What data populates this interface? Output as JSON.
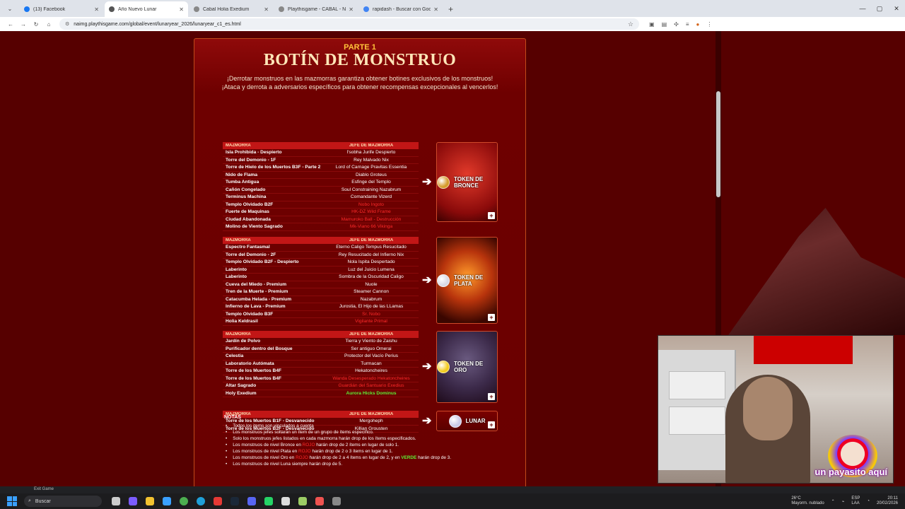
{
  "browser": {
    "tabs": [
      {
        "title": "(13) Facebook",
        "color": "#1877f2",
        "active": false
      },
      {
        "title": "Año Nuevo Lunar",
        "color": "#555",
        "active": true
      },
      {
        "title": "Cabal Holia Exedium",
        "color": "#888",
        "active": false
      },
      {
        "title": "Playthisgame - CABAL - Notici",
        "color": "#888",
        "active": false
      },
      {
        "title": "rapidash - Buscar con Google",
        "color": "#4285f4",
        "active": false
      }
    ],
    "url": "naimg.playthisgame.com/global/event/lunaryear_2026/lunaryear_c1_es.html"
  },
  "page": {
    "part": "PARTE 1",
    "title": "BOTÍN DE MONSTRUO",
    "intro_1": "¡Derrotar monstruos en las mazmorras garantiza obtener botines exclusivos de los monstruos!",
    "intro_2": "¡Ataca y derrota a adversarios específicos para obtener recompensas excepcionales al vencerlos!",
    "col_dungeon": "MAZMORRA",
    "col_boss": "JEFE DE MAZMORRA",
    "groups": [
      {
        "token": "TOKEN DE BRONCE",
        "coin_color": "#d59a2a",
        "card_bg": "radial-gradient(circle at 50% 40%,#e23a2a,#8a0a0a 70%,#3a0000)",
        "rows": [
          [
            "Isla Prohibida - Despierto",
            "l'sobha Jurife Despierto",
            ""
          ],
          [
            "Torre del Demonio - 1F",
            "Rey Malvado Nix",
            ""
          ],
          [
            "Torre de Hielo de los Muertos B3F - Parte 2",
            "Lord of Carnage Pravitas Essentia",
            ""
          ],
          [
            "Nido de Flama",
            "Diablo Groteus",
            ""
          ],
          [
            "Tumba Antigua",
            "Esfinge del Templo",
            ""
          ],
          [
            "Cañón Congelado",
            "Soul Constraining Nazabrum",
            ""
          ],
          [
            "Terminus Machina",
            "Comandante Vizerd",
            ""
          ],
          [
            "Templo Olvidado B2F",
            "Nobo Ingoto",
            "red"
          ],
          [
            "Fuerte de Maquinas",
            "HK-DZ Wild Frame",
            "red"
          ],
          [
            "Ciudad Abandonada",
            "Mamuroko Ball - Destrucción",
            "red"
          ],
          [
            "Molino de Viento Sagrado",
            "Mk-Viano 66 Vikinga",
            "red"
          ]
        ]
      },
      {
        "token": "TOKEN DE PLATA",
        "coin_color": "#d8d8e4",
        "card_bg": "radial-gradient(circle at 50% 45%,#ff9a2a,#b8340c 45%,#3a0600 85%)",
        "rows": [
          [
            "Espectro Fantasmal",
            "Eterno Caligo Tempus Resucitado",
            ""
          ],
          [
            "Torre del Demonio - 2F",
            "Rey Resucitado del Infierno Nix",
            ""
          ],
          [
            "Templo Olvidado B2F - Despierto",
            "Nola Ispita Despertado",
            ""
          ],
          [
            "Laberinto",
            "Luz del Juicio Lumena",
            ""
          ],
          [
            "Laberinto",
            "Sombra de la Oscuridad Caligo",
            ""
          ],
          [
            "Cueva del Miedo - Premium",
            "Nuole",
            ""
          ],
          [
            "Tren de la Muerte - Premium",
            "Steamer Cannon",
            ""
          ],
          [
            "Catacumba Helada - Premium",
            "Nazabrum",
            ""
          ],
          [
            "Infierno de Lava - Premium",
            "Jurostia, El Hijo de las LLamas",
            ""
          ],
          [
            "Templo Olvidado B3F",
            "Sr. Nobo",
            "red"
          ],
          [
            "Holia Keldrasil",
            "Vigilante Primal",
            "red"
          ]
        ]
      },
      {
        "token": "TOKEN DE ORO",
        "coin_color": "#f2cc1e",
        "card_bg": "radial-gradient(circle at 50% 40%,#6a5a80,#3c2a4a 55%,#1e0a1a)",
        "rows": [
          [
            "Jardín de Polvo",
            "Tierra y Viento de Zaishu",
            ""
          ],
          [
            "Purificador dentro del Bosque",
            "Ser antiguo Omerai",
            ""
          ],
          [
            "Celestia",
            "Protector del Vacío Perius",
            ""
          ],
          [
            "Laboratorio Autómata",
            "Turmacan",
            ""
          ],
          [
            "Torre de los Muertos B4F",
            "Hekatoncheires",
            ""
          ],
          [
            "Torre de los Muertos B4F",
            "Wanda Desesperado Hekatoncheires",
            "red"
          ],
          [
            "Altar Sagrado",
            "Guardián del Santuario Exedius",
            "red"
          ],
          [
            "Holy Exedium",
            "Aurora Hicks Dominus",
            "green"
          ]
        ]
      },
      {
        "token": "LUNAR",
        "coin_color": "#c9c9e8",
        "card_bg": "linear-gradient(#7a0000,#5a0000)",
        "rows": [
          [
            "Torre de los Muertos B1F - Desvanecido",
            "Mergoheph",
            ""
          ],
          [
            "Torre de los Muertos B2F - Desvanecido",
            "Killian Grousten",
            ""
          ]
        ]
      }
    ],
    "notes_title": "NOTAS",
    "notes": [
      {
        "parts": [
          [
            "Todos los items son vinculados a cuenta",
            ""
          ]
        ]
      },
      {
        "parts": [
          [
            "Los monstruos jefes soltarán un ítem de un grupo de ítems específico.",
            ""
          ]
        ]
      },
      {
        "parts": [
          [
            "Solo los monstruos jefes listados en cada mazmorra harán drop de los ítems especificados.",
            ""
          ]
        ]
      },
      {
        "parts": [
          [
            "Los monstruos de nivel Bronce en ",
            ""
          ],
          [
            "ROJO",
            "red"
          ],
          [
            " harán drop de 2 ítems en lugar de solo 1.",
            ""
          ]
        ]
      },
      {
        "parts": [
          [
            "Los monstruos de nivel Plata en ",
            ""
          ],
          [
            "ROJO",
            "red"
          ],
          [
            " harán drop de 2 o 3 ítems en lugar de 1.",
            ""
          ]
        ]
      },
      {
        "parts": [
          [
            "Los monstruos de nivel Oro en ",
            ""
          ],
          [
            "ROJO",
            "red"
          ],
          [
            " harán drop de 2 a 4 ítems en lugar de 2, y en ",
            ""
          ],
          [
            "VERDE",
            "green"
          ],
          [
            " harán drop de 3.",
            ""
          ]
        ]
      },
      {
        "parts": [
          [
            "Los monstruos de nivel Luna siempre harán drop de 5.",
            ""
          ]
        ]
      }
    ]
  },
  "webcam": {
    "caption": "un payasito aquí"
  },
  "taskbar": {
    "exit_label": "Exit Game",
    "search_placeholder": "Buscar",
    "weather_temp": "26°C",
    "weather_desc": "Mayorm. nublado",
    "lang": "ESP",
    "lang2": "LAA",
    "time": "20:11",
    "date": "20/02/2026"
  }
}
